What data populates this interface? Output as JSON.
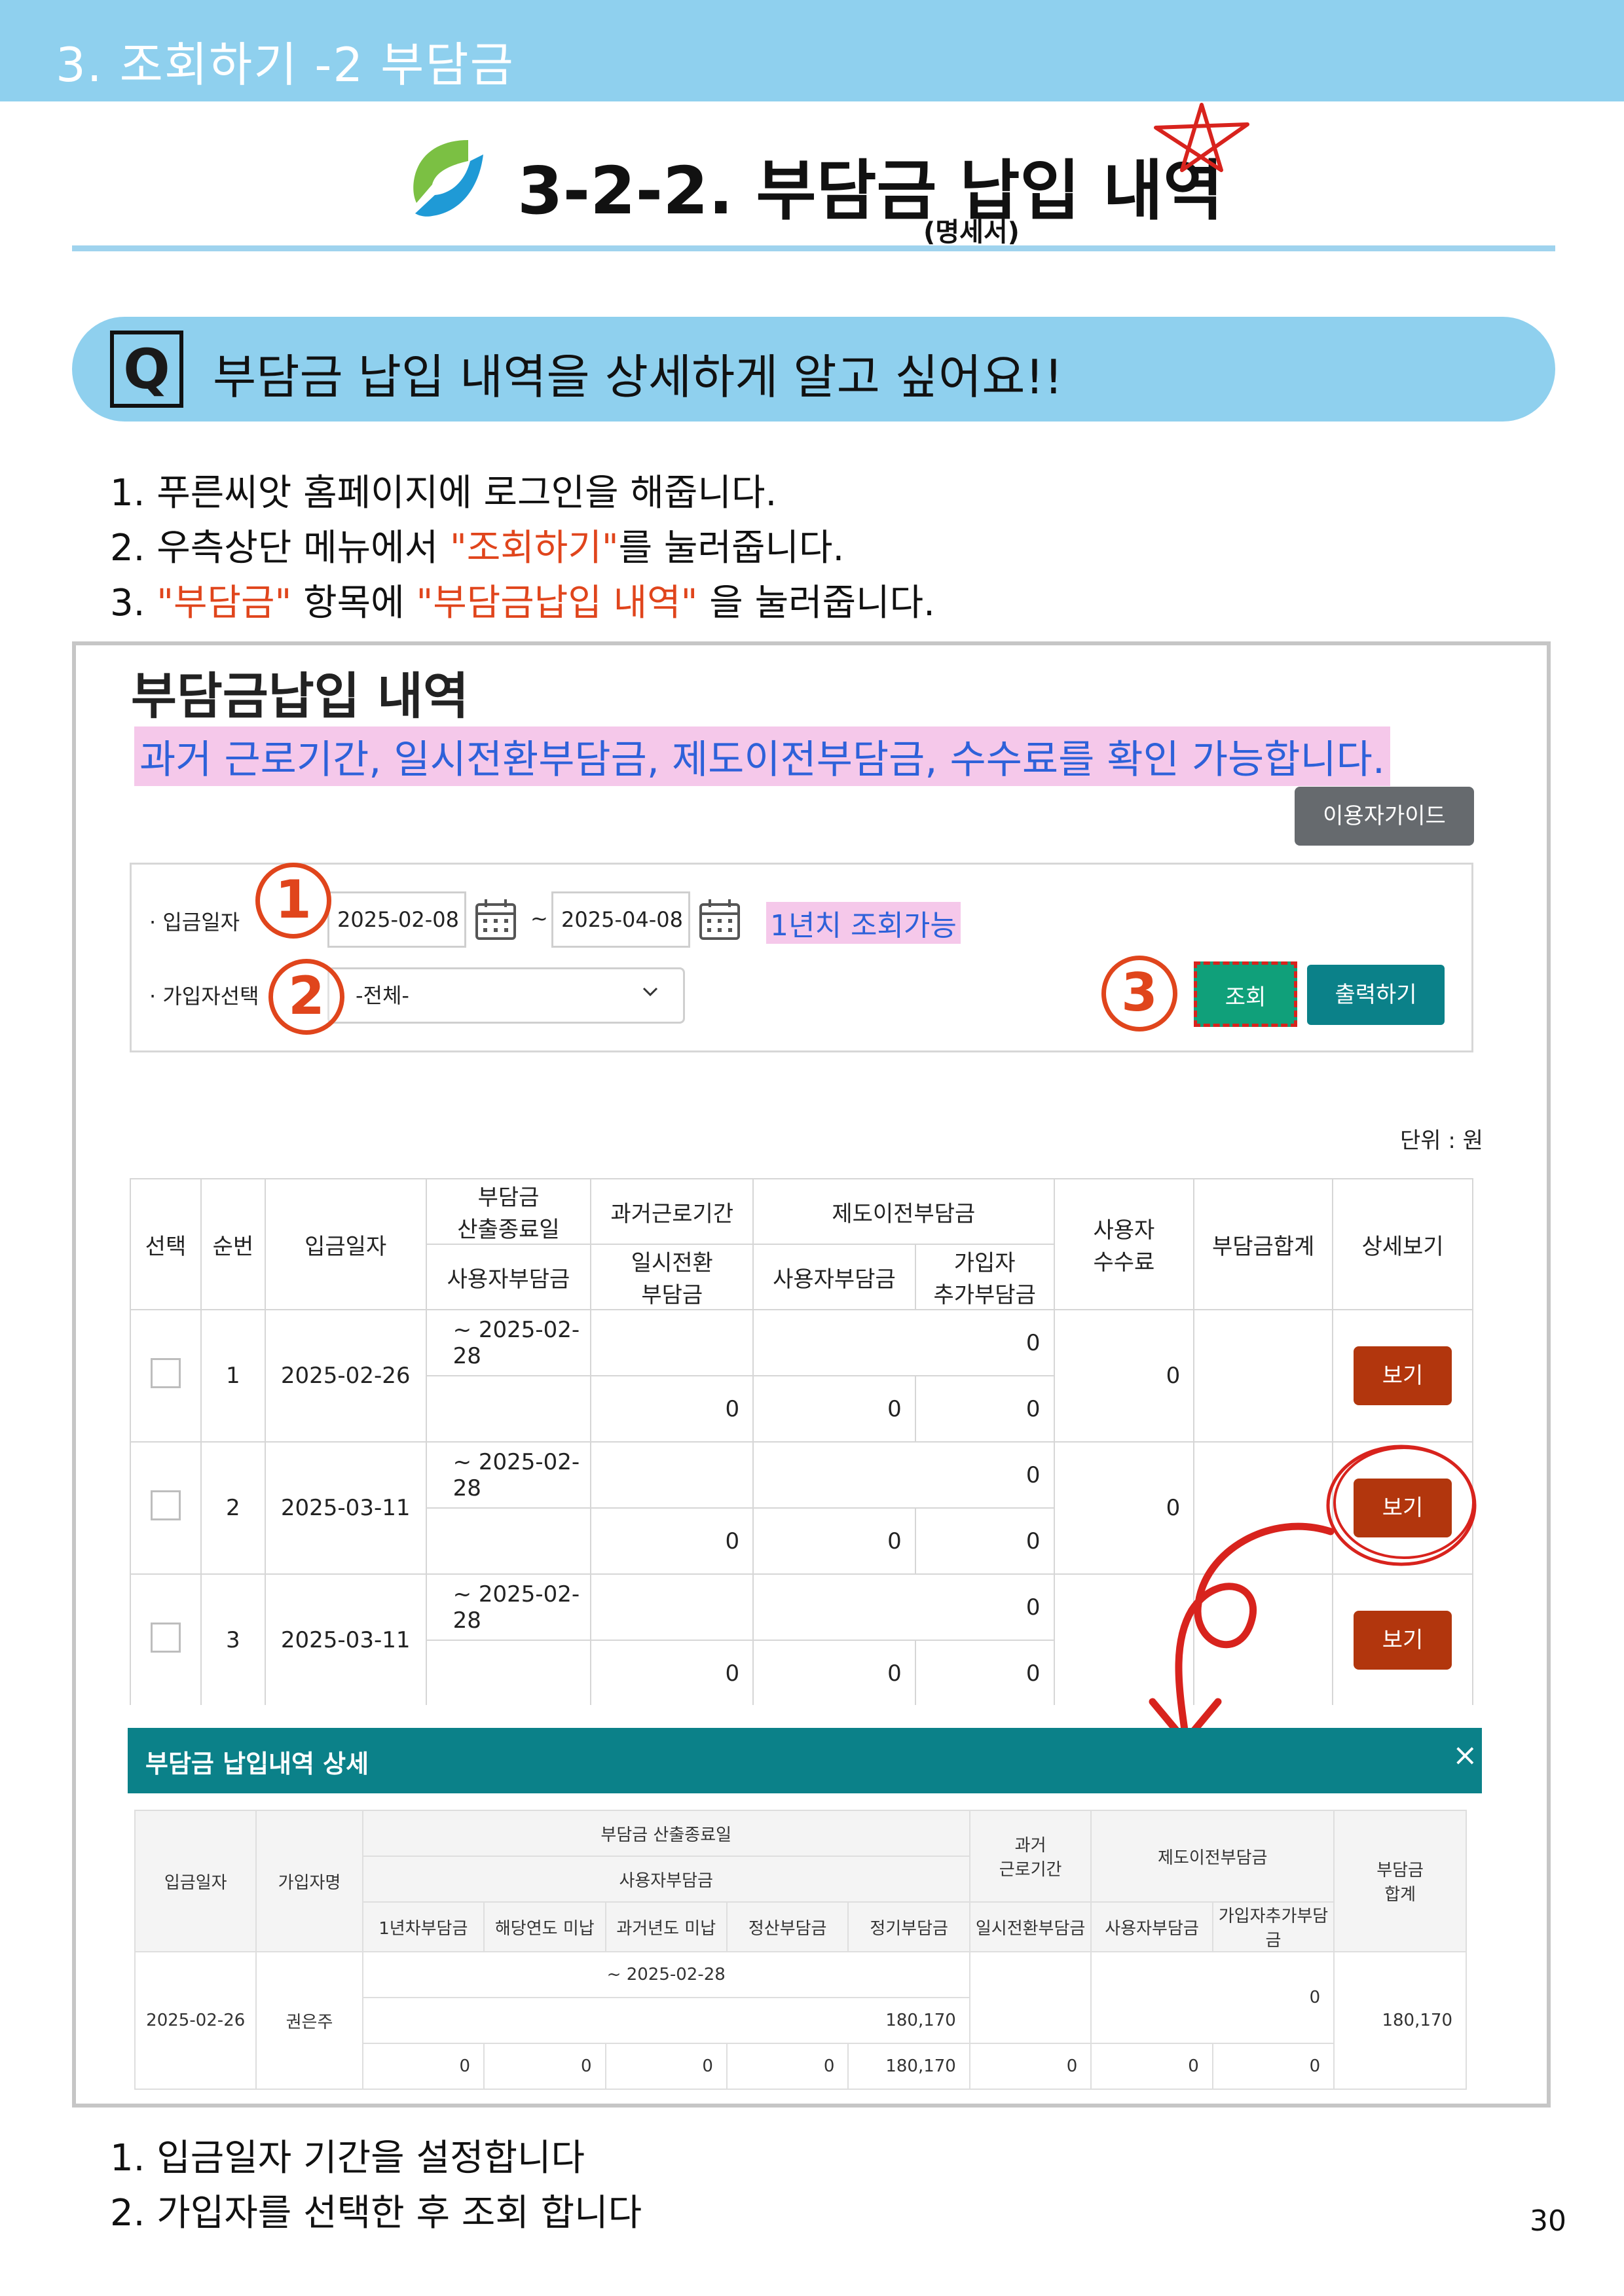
{
  "banner": {
    "title": "3. 조회하기 -2 부담금"
  },
  "title": {
    "main": "3-2-2. 부담금 납입 내역",
    "sub": "(명세서)"
  },
  "question": {
    "badge": "Q",
    "text": "부담금 납입 내역을 상세하게 알고 싶어요!!"
  },
  "steps_top": {
    "s1": "1. 푸른씨앗 홈페이지에 로그인을 해줍니다.",
    "s2_pre": "2.  우측상단 메뉴에서 ",
    "s2_red": "\"조회하기\"",
    "s2_post": "를 눌러줍니다.",
    "s3_pre": "3.  ",
    "s3_red1": "\"부담금\"",
    "s3_mid": " 항목에 ",
    "s3_red2": "\"부담금납입 내역\"",
    "s3_post": " 을 눌러줍니다."
  },
  "screen": {
    "title": "부담금납입 내역",
    "desc": "과거 근로기간, 일시전환부담금, 제도이전부담금, 수수료를 확인 가능합니다.",
    "guide_btn": "이용자가이드",
    "date_label": "· 입금일자",
    "date_from": "2025-02-08",
    "date_sep": "~",
    "date_to": "2025-04-08",
    "range_note": "1년치 조회가능",
    "member_label": "· 가입자선택",
    "member_value": "-전체-",
    "search_btn": "조회",
    "print_btn": "출력하기",
    "markers": [
      "1",
      "2",
      "3"
    ],
    "unit": "단위 : 원",
    "accent_red": "#e0451c",
    "teal": "#0b8189"
  },
  "main_table": {
    "headers": {
      "select": "선택",
      "seq": "순번",
      "date": "입금일자",
      "calc_end": "부담금\n산출종료일",
      "past": "과거근로기간",
      "transfer": "제도이전부담금",
      "fee": "사용자\n수수료",
      "total": "부담금합계",
      "detail": "상세보기",
      "employer": "사용자부담금",
      "temp": "일시전환\n부담금",
      "transfer_emp": "사용자부담금",
      "transfer_mem": "가입자\n추가부담금"
    },
    "rows": [
      {
        "seq": "1",
        "date": "2025-02-26",
        "end": "~ 2025-02-28",
        "past_top": "0",
        "employer": "0",
        "temp": "0",
        "t_emp": "0",
        "t_mem": "0",
        "fee": "0",
        "view": "보기"
      },
      {
        "seq": "2",
        "date": "2025-03-11",
        "end": "~ 2025-02-28",
        "past_top": "0",
        "employer": "0",
        "temp": "0",
        "t_emp": "0",
        "t_mem": "0",
        "fee": "0",
        "view": "보기"
      },
      {
        "seq": "3",
        "date": "2025-03-11",
        "end": "~ 2025-02-28",
        "past_top": "0",
        "employer": "0",
        "temp": "0",
        "t_emp": "0",
        "t_mem": "0",
        "fee": "",
        "view": "보기"
      }
    ]
  },
  "modal": {
    "title": "부담금 납입내역 상세",
    "close": "×",
    "headers": {
      "date": "입금일자",
      "member": "가입자명",
      "calc_end": "부담금 산출종료일",
      "employer": "사용자부담금",
      "past": "과거\n근로기간",
      "transfer": "제도이전부담금",
      "total": "부담금\n합계",
      "c1": "1년차부담금",
      "c2": "해당연도 미납",
      "c3": "과거년도 미납",
      "c4": "정산부담금",
      "c5": "정기부담금",
      "c6": "일시전환부담금",
      "c7": "사용자부담금",
      "c8": "가입자추가부담금"
    },
    "row": {
      "date": "2025-02-26",
      "member": "권은주",
      "end": "~ 2025-02-28",
      "sum_employer": "180,170",
      "transfer_top": "0",
      "total": "180,170",
      "c1": "0",
      "c2": "0",
      "c3": "0",
      "c4": "0",
      "c5": "180,170",
      "c6": "0",
      "c7": "0",
      "c8": "0"
    }
  },
  "steps_bottom": {
    "s1": "1. 입금일자 기간을 설정합니다",
    "s2": "2. 가입자를 선택한 후 조회 합니다"
  },
  "page_number": "30"
}
